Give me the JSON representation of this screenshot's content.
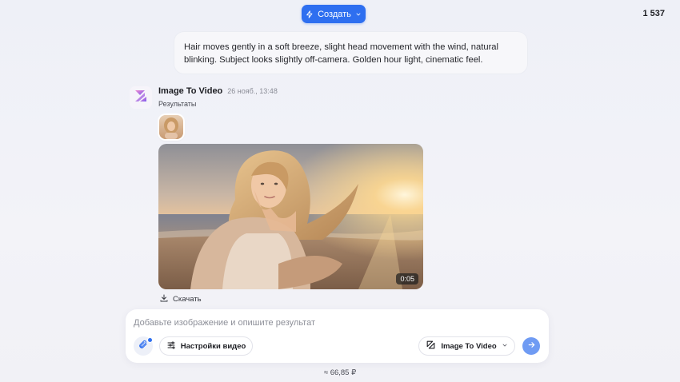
{
  "header": {
    "create_label": "Создать",
    "balance": "1 537"
  },
  "prompt": {
    "text": "Hair moves gently in a soft breeze, slight head movement with the wind, natural blinking. Subject looks slightly off-camera. Golden hour light, cinematic feel."
  },
  "message": {
    "title": "Image To Video",
    "timestamp": "26 нояб., 13:48",
    "results_label": "Результаты",
    "video_duration": "0:05",
    "download_label": "Скачать"
  },
  "composer": {
    "placeholder": "Добавьте изображение и опишите результат",
    "value": "",
    "settings_label": "Настройки видео",
    "model_label": "Image To Video"
  },
  "footer": {
    "price": "≈ 66,85 ₽"
  },
  "colors": {
    "accent": "#2e6ff0",
    "send": "#6f9bf3",
    "background": "#eef0f7"
  },
  "icons": {
    "create": "sparkle-icon",
    "create_chevron": "chevron-down-icon",
    "download": "download-icon",
    "attach": "paperclip-icon",
    "settings": "sliders-icon",
    "model": "model-logo-icon",
    "model_chevron": "chevron-down-icon",
    "send": "arrow-right-icon"
  }
}
